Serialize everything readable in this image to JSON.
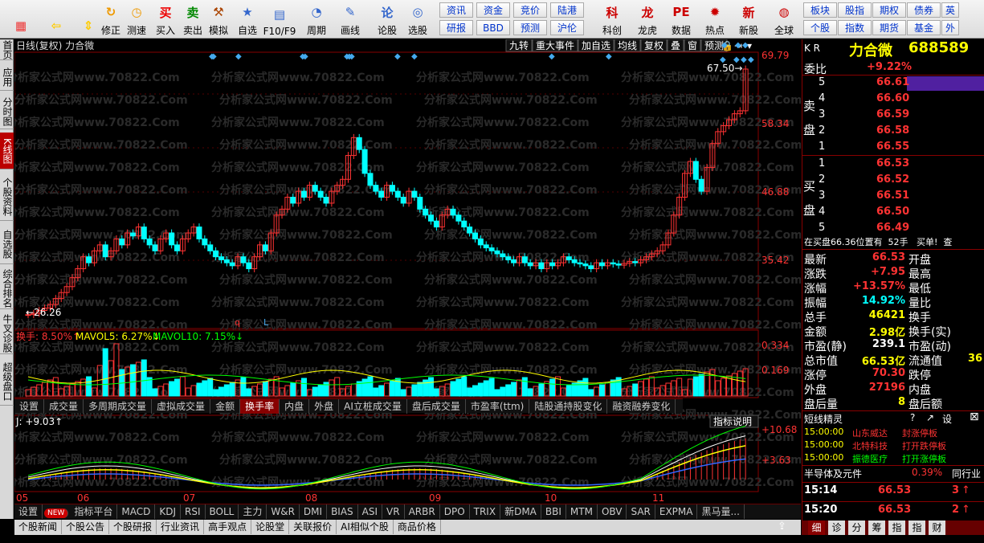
{
  "toolbar": {
    "left_tools": [
      {
        "label": "",
        "icon": "windows-icon",
        "color": "#e33"
      },
      {
        "label": "",
        "icon": "back-arrow-icon",
        "color": "#fc0"
      },
      {
        "label": "",
        "icon": "updown-icon",
        "color": "#fc0"
      },
      {
        "label": "修正",
        "icon": "refresh-icon",
        "color": "#e90"
      },
      {
        "label": "测速",
        "icon": "clock-icon",
        "color": "#e90"
      },
      {
        "label": "买入",
        "icon": "buy-icon",
        "color": "#e00"
      },
      {
        "label": "卖出",
        "icon": "sell-icon",
        "color": "#080"
      },
      {
        "label": "模拟",
        "icon": "hammer-icon",
        "color": "#a40"
      },
      {
        "label": "自选",
        "icon": "star-icon",
        "color": "#36c"
      },
      {
        "label": "F10/F9",
        "icon": "f10-icon",
        "color": "#36c"
      },
      {
        "label": "周期",
        "icon": "cycle-icon",
        "color": "#36c"
      },
      {
        "label": "画线",
        "icon": "pen-icon",
        "color": "#36c"
      },
      {
        "label": "论股",
        "icon": "discuss-icon",
        "color": "#36c"
      },
      {
        "label": "选股",
        "icon": "select-icon",
        "color": "#36c"
      }
    ],
    "square_buttons": [
      [
        "资讯",
        "资金",
        "竞价",
        "陆港"
      ],
      [
        "研报",
        "BBD",
        "预测",
        "沪伦"
      ]
    ],
    "right_tools": [
      {
        "label": "科创",
        "icon": "kechuang-icon"
      },
      {
        "label": "龙虎",
        "icon": "dragon-icon"
      },
      {
        "label": "数据",
        "icon": "pe-icon"
      },
      {
        "label": "热点",
        "icon": "hot-icon"
      },
      {
        "label": "新股",
        "icon": "ipo-icon"
      },
      {
        "label": "全球",
        "icon": "globe-icon"
      }
    ],
    "square_buttons2": [
      [
        "板块",
        "股指",
        "期权",
        "债券",
        "英"
      ],
      [
        "个股",
        "指数",
        "期货",
        "基金",
        "外"
      ]
    ]
  },
  "leftnav": [
    "首页",
    "应用",
    "分时图",
    "K线图",
    "个股资料",
    "自选股",
    "综合排名",
    "牛叉诊股",
    "超级盘口"
  ],
  "chart": {
    "header": "日线(复权)  力合微",
    "top_buttons": [
      "九转",
      "重大事件",
      "加自选",
      "均线",
      "复权",
      "叠",
      "窗",
      "预测"
    ],
    "price_labels": [
      "69.79",
      "58.34",
      "46.88",
      "35.42"
    ],
    "max_label": "67.50",
    "min_label": "26.26",
    "vol_header": {
      "turnover": "换手: 8.50%↑",
      "mavol5": "MAVOL5: 6.27%↓",
      "mavol10": "MAVOL10: 7.15%↓"
    },
    "vol_labels": [
      "0.334",
      "0.169"
    ],
    "kdj_header": "J: +9.03↑",
    "kdj_labels": [
      "+10.68",
      "+3.63"
    ],
    "kdj_explain": "指标说明",
    "x_labels": [
      "05",
      "06",
      "07",
      "08",
      "09",
      "10",
      "11"
    ],
    "markers": [
      "q",
      "L"
    ],
    "watermark": "分析家公式网www.70822.Com"
  },
  "vol_tabs": [
    "设置",
    "成交量",
    "多周期成交量",
    "虚拟成交量",
    "金额",
    "换手率",
    "内盘",
    "外盘",
    "AI立桩成交量",
    "盘后成交量",
    "市盈率(ttm)",
    "陆股通持股变化",
    "融资融券变化"
  ],
  "indicator_tabs": [
    "设置",
    "NEW",
    "指标平台",
    "MACD",
    "KDJ",
    "RSI",
    "BOLL",
    "主力",
    "W&R",
    "DMI",
    "BIAS",
    "ASI",
    "VR",
    "ARBR",
    "DPO",
    "TRIX",
    "新DMA",
    "BBI",
    "MTM",
    "OBV",
    "SAR",
    "EXPMA",
    "黑马量..."
  ],
  "news_tabs": [
    "个股新闻",
    "个股公告",
    "个股研报",
    "行业资讯",
    "高手观点",
    "论股堂",
    "关联报价",
    "AI相似个股",
    "商品价格"
  ],
  "quote": {
    "kr": "K R",
    "name": "力合微",
    "code": "688589",
    "weibi_label": "委比",
    "weibi": "+9.22%",
    "sell_label": "卖盘",
    "buy_label": "买盘",
    "sells": [
      [
        "5",
        "66.61"
      ],
      [
        "4",
        "66.60"
      ],
      [
        "3",
        "66.59"
      ],
      [
        "2",
        "66.58"
      ],
      [
        "1",
        "66.55"
      ]
    ],
    "buys": [
      [
        "1",
        "66.53"
      ],
      [
        "2",
        "66.52"
      ],
      [
        "3",
        "66.51"
      ],
      [
        "4",
        "66.50"
      ],
      [
        "5",
        "66.49"
      ]
    ],
    "notice": "在买盘66.36位置有  52手   买单!  查",
    "stats": [
      [
        "最新",
        "66.53",
        "开盘"
      ],
      [
        "涨跌",
        "+7.95",
        "最高"
      ],
      [
        "涨幅",
        "+13.57%",
        "最低"
      ],
      [
        "振幅",
        "14.92%",
        "量比"
      ],
      [
        "总手",
        "46421",
        "换手"
      ],
      [
        "金额",
        "2.98亿",
        "换手(实)"
      ],
      [
        "市盈(静)",
        "239.1",
        "市盈(动)"
      ],
      [
        "总市值",
        "66.53亿",
        "流通值"
      ],
      [
        "涨停",
        "70.30",
        "跌停"
      ],
      [
        "外盘",
        "27196",
        "内盘"
      ],
      [
        "盘后量",
        "8",
        "盘后额"
      ]
    ],
    "stat_colors": [
      "#ff3333",
      "#ff3333",
      "#ff3333",
      "#00ffff",
      "#ffff00",
      "#ffff00",
      "#ffffff",
      "#ffff00",
      "#ff3333",
      "#ff3333",
      "#ffff00"
    ],
    "extra_circ": "36",
    "elf_title": "短线精灵",
    "elf_items": [
      [
        "15:00:00",
        "山东威达",
        "封涨停板"
      ],
      [
        "15:00:00",
        "北特科技",
        "打开跌停板"
      ],
      [
        "15:00:00",
        "振德医疗",
        "打开涨停板"
      ]
    ],
    "sector": "半导体及元件",
    "sector_pct": "0.39%",
    "sector_btn": "同行业",
    "ticks": [
      [
        "15:14",
        "66.53",
        "3"
      ],
      [
        "15:20",
        "66.53",
        "2"
      ]
    ]
  },
  "bottom_tabs": [
    "细",
    "诊",
    "分",
    "筹",
    "指",
    "指",
    "财"
  ]
}
